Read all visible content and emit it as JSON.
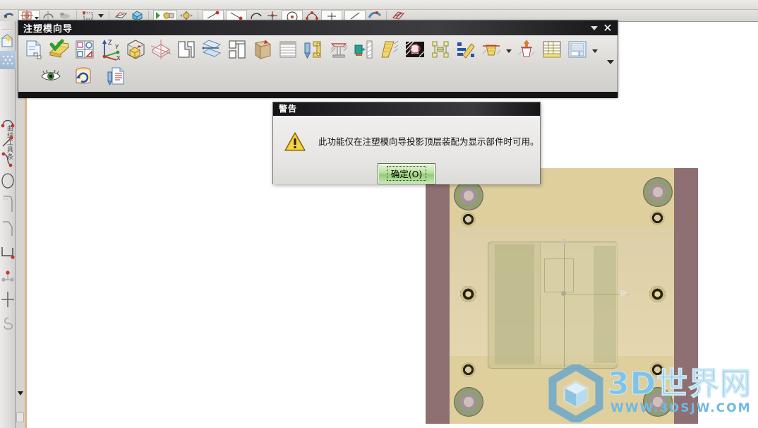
{
  "app": {
    "background_color": "#ffffff",
    "left_toolbar": {
      "name": "sketch-curve-toolbar",
      "vertical_label": "曲线工具条",
      "items": [
        {
          "name": "sketch-icon",
          "label": "草图"
        },
        {
          "name": "pattern-fill-icon",
          "label": "图样填充"
        },
        {
          "name": "arc-two-point-icon",
          "label": "圆弧"
        },
        {
          "name": "line-icon",
          "label": "直线"
        },
        {
          "name": "curve-icon",
          "label": "艺术样条"
        },
        {
          "name": "circle-icon",
          "label": "圆"
        },
        {
          "name": "fillet-icon",
          "label": "圆角"
        },
        {
          "name": "chamfer-icon",
          "label": "倒斜角"
        },
        {
          "name": "rectangle-icon",
          "label": "矩形"
        },
        {
          "name": "point-set-icon",
          "label": "点集"
        },
        {
          "name": "offset-curve-icon",
          "label": "偏置曲线"
        },
        {
          "name": "helix-icon",
          "label": "螺旋线"
        }
      ]
    },
    "ribbon": {
      "name": "top-ribbon",
      "items": [
        {
          "name": "undo-icon"
        },
        {
          "name": "datum-csys-icon"
        },
        {
          "name": "undo-curve-icon"
        },
        {
          "name": "rotate-icon"
        },
        {
          "name": "sketch-rect-icon"
        },
        {
          "name": "extrude-icon"
        },
        {
          "name": "box-icon"
        },
        {
          "name": "play-assembly-icon"
        },
        {
          "name": "move-component-icon"
        },
        {
          "name": "line-tool-icon"
        },
        {
          "name": "line-slope-icon"
        },
        {
          "name": "arc-tool-icon"
        },
        {
          "name": "point-cross-icon"
        },
        {
          "name": "circle-center-icon"
        },
        {
          "name": "arc-3point-icon"
        },
        {
          "name": "point-icon"
        },
        {
          "name": "line-simple-icon"
        },
        {
          "name": "spline-icon"
        },
        {
          "name": "mesh-surface-icon"
        }
      ]
    },
    "scrollbar": {
      "name": "vertical-scrollbar"
    }
  },
  "mold_wizard_window": {
    "title": "注塑模向导",
    "title_dropdown_icon": "chevron-down-icon",
    "close_icon": "close-icon",
    "toolbar_row1": [
      {
        "name": "project-initialize-icon",
        "label": "初始化项目"
      },
      {
        "name": "mold-csys-icon",
        "label": "模具CSYS"
      },
      {
        "name": "shrinkage-icon",
        "label": "收缩率"
      },
      {
        "name": "workpiece-csys-icon",
        "label": "工件坐标"
      },
      {
        "name": "workpiece-icon",
        "label": "工件"
      },
      {
        "name": "cavity-layout-icon",
        "label": "型腔布局"
      },
      {
        "name": "mold-tools-icon",
        "label": "注塑模工具"
      },
      {
        "name": "mold-split-icon",
        "label": "模具分型工具"
      },
      {
        "name": "mold-base-library-icon",
        "label": "模架库"
      },
      {
        "name": "standard-part-library-icon",
        "label": "标准件库"
      },
      {
        "name": "slide-lifter-icon",
        "label": "滑块和浮升销库"
      },
      {
        "name": "sub-insert-library-icon",
        "label": "子镶块库"
      },
      {
        "name": "gate-library-icon",
        "label": "浇口库"
      },
      {
        "name": "runner-icon",
        "label": "流道"
      },
      {
        "name": "mold-cooling-tools-icon",
        "label": "模具冷却工具"
      },
      {
        "name": "electrode-icon",
        "label": "电极"
      },
      {
        "name": "trim-mold-components-icon",
        "label": "修边模具组件"
      },
      {
        "name": "trim-dropdown-icon",
        "label": ""
      },
      {
        "name": "cavity-pocket-icon",
        "label": "腔体"
      },
      {
        "name": "bill-of-material-icon",
        "label": "物料清单"
      },
      {
        "name": "drawing-icon",
        "label": "装配图纸"
      },
      {
        "name": "drawing-dropdown-icon",
        "label": ""
      }
    ],
    "toolbar_row2": [
      {
        "name": "view-manager-icon",
        "label": "视图管理器"
      },
      {
        "name": "replace-solid-icon",
        "label": "替换实体"
      },
      {
        "name": "concept-design-icon",
        "label": "设计文件"
      }
    ],
    "overflow_chevron_icon": "chevron-down-icon"
  },
  "warning_dialog": {
    "title": "警告",
    "icon": "warning-triangle-icon",
    "message": "此功能仅在注塑模向导投影顶层装配为显示部件时可用。",
    "ok_button": "确定(O)",
    "accent_color": "#8fcd74"
  },
  "model": {
    "name": "mold-base-3d-model",
    "colors": {
      "plate_side": "#8e6f72",
      "core_plate": "#decf9c",
      "inner_plate": "#e4d6ae",
      "insert": "#bebc8c"
    },
    "guide_pillars": 4,
    "screws": 6
  },
  "watermark": {
    "logo_icon": "cube-hexagon-logo",
    "text": "3D世界网",
    "url": "WWW.3DSJW.COM",
    "color": "#7ec4ea"
  }
}
